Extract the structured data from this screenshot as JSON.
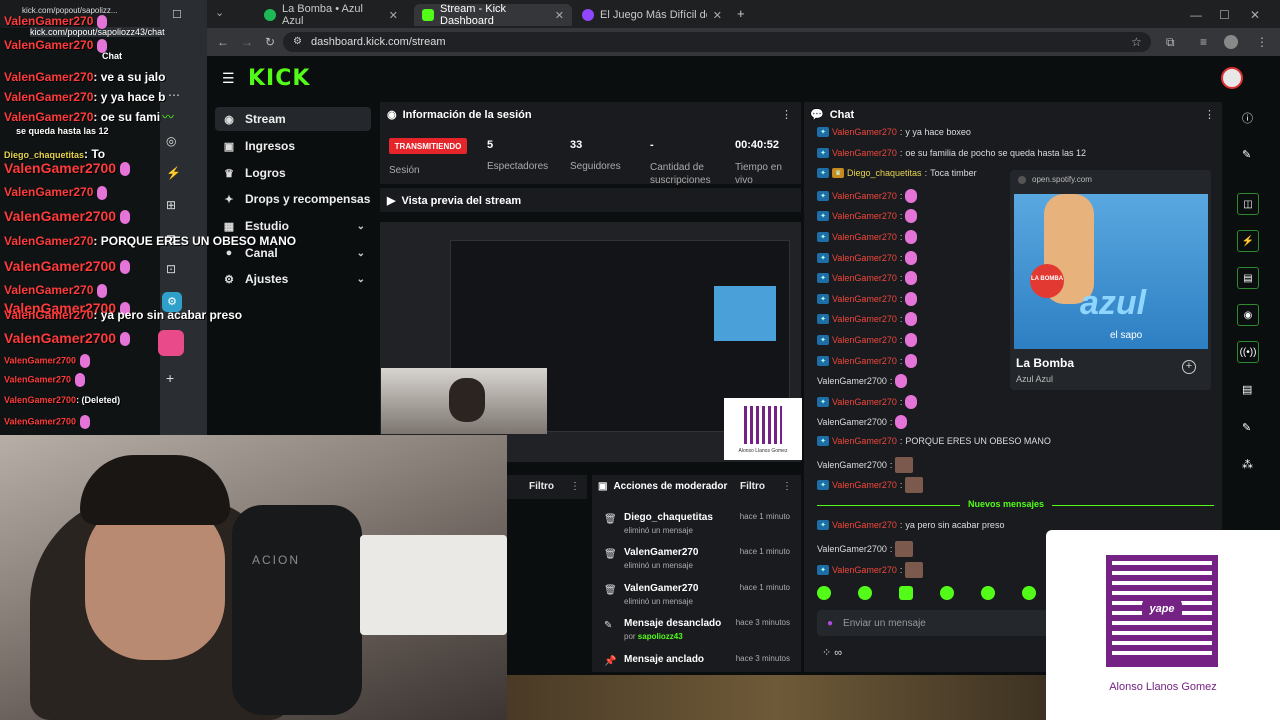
{
  "browser": {
    "tabs": [
      {
        "title": "La Bomba • Azul Azul",
        "color": "#1db954"
      },
      {
        "title": "Stream - Kick Dashboard",
        "color": "#53fc18"
      },
      {
        "title": "El Juego Más Difícil del Mundo",
        "color": "#9146ff"
      }
    ],
    "url": "dashboard.kick.com/stream",
    "popout_url": "kick.com/popout/sapoliozz43/chat",
    "popout_url_short": "kick.com/popout/sapolizz..."
  },
  "sidebar": {
    "items": [
      {
        "label": "Stream",
        "icon": "broadcast-icon"
      },
      {
        "label": "Ingresos",
        "icon": "wallet-icon"
      },
      {
        "label": "Logros",
        "icon": "trophy-icon"
      },
      {
        "label": "Drops y recompensas",
        "icon": "gift-icon"
      },
      {
        "label": "Estudio",
        "icon": "layout-icon"
      },
      {
        "label": "Canal",
        "icon": "user-icon"
      },
      {
        "label": "Ajustes",
        "icon": "gear-icon"
      }
    ]
  },
  "session": {
    "title": "Información de la sesión",
    "status": "TRANSMITIENDO",
    "status_caption": "Sesión",
    "stats": [
      {
        "value": "5",
        "label": "Espectadores"
      },
      {
        "value": "33",
        "label": "Seguidores"
      },
      {
        "value": "-",
        "label": "Cantidad de suscripciones"
      },
      {
        "value": "00:40:52",
        "label": "Tiempo en vivo"
      }
    ]
  },
  "preview": {
    "title": "Vista previa del stream"
  },
  "filter_label": "Filtro",
  "mod_actions": {
    "title": "Acciones de moderador",
    "filter": "Filtro",
    "rows": [
      {
        "user": "Diego_chaquetitas",
        "action": "eliminó un mensaje",
        "time": "hace 1 minuto"
      },
      {
        "user": "ValenGamer270",
        "action": "eliminó un mensaje",
        "time": "hace 1 minuto"
      },
      {
        "user": "ValenGamer270",
        "action": "eliminó un mensaje",
        "time": "hace 1 minuto"
      },
      {
        "user": "Mensaje desanclado",
        "action": "por",
        "by": "sapoliozz43",
        "time": "hace 3 minutos"
      },
      {
        "user": "Mensaje anclado",
        "action": "",
        "time": "hace 3 minutos"
      }
    ]
  },
  "chat": {
    "title": "Chat",
    "new_messages": "Nuevos mensajes",
    "input_placeholder": "Enviar un mensaje",
    "messages": [
      {
        "user": "ValenGamer270",
        "text": "y ya hace boxeo"
      },
      {
        "user": "ValenGamer270",
        "text": "oe su familia de pocho se queda hasta las 12"
      },
      {
        "user": "Diego_chaquetitas",
        "text": "Toca timber"
      },
      {
        "user": "ValenGamer270",
        "text": ""
      },
      {
        "user": "ValenGamer270",
        "text": ""
      },
      {
        "user": "ValenGamer270",
        "text": ""
      },
      {
        "user": "ValenGamer270",
        "text": ""
      },
      {
        "user": "ValenGamer270",
        "text": ""
      },
      {
        "user": "ValenGamer270",
        "text": ""
      },
      {
        "user": "ValenGamer270",
        "text": ""
      },
      {
        "user": "ValenGamer270",
        "text": ""
      },
      {
        "user": "ValenGamer270",
        "text": ""
      },
      {
        "user": "ValenGamer2700",
        "text": ""
      },
      {
        "user": "ValenGamer270",
        "text": ""
      },
      {
        "user": "ValenGamer2700",
        "text": ""
      },
      {
        "user": "ValenGamer270",
        "text": "PORQUE ERES UN OBESO MANO"
      },
      {
        "user": "ValenGamer2700",
        "text": ""
      },
      {
        "user": "ValenGamer270",
        "text": ""
      }
    ],
    "after_new": [
      {
        "user": "ValenGamer270",
        "text": "ya pero sin acabar preso"
      },
      {
        "user": "ValenGamer2700",
        "text": ""
      },
      {
        "user": "ValenGamer270",
        "text": ""
      }
    ]
  },
  "spotify": {
    "domain": "open.spotify.com",
    "song": "La Bomba",
    "artist": "Azul Azul",
    "cover_word": "azul",
    "cover_small": "el sapo",
    "cover_sticker": "LA BOMBA"
  },
  "overlay_chat": {
    "label": "Chat",
    "lines": [
      {
        "name": "ValenGamer270",
        "text": ""
      },
      {
        "name": "ValenGamer270",
        "text": ""
      },
      {
        "name": "ValenGamer270",
        "text": ": ve a su jalo"
      },
      {
        "name": "ValenGamer270",
        "text": ": y ya hace b"
      },
      {
        "name": "ValenGamer270",
        "text": ": oe su fami"
      },
      {
        "name": "",
        "text": "se queda hasta las 12"
      },
      {
        "name": "Diego_chaquetitas",
        "text": ": To"
      },
      {
        "name": "ValenGamer2700",
        "text": ""
      },
      {
        "name": "ValenGamer270",
        "text": ""
      },
      {
        "name": "ValenGamer2700",
        "text": ""
      },
      {
        "name": "ValenGamer270",
        "text": ": PORQUE ERES UN OBESO MANO"
      },
      {
        "name": "ValenGamer2700",
        "text": ""
      },
      {
        "name": "ValenGamer270",
        "text": ""
      },
      {
        "name": "ValenGamer2700",
        "text": ""
      },
      {
        "name": "ValenGamer270",
        "text": ": ya pero sin acabar preso"
      },
      {
        "name": "ValenGamer2700",
        "text": ""
      },
      {
        "name": "ValenGamer2700",
        "text": ""
      },
      {
        "name": "ValenGamer270",
        "text": ""
      },
      {
        "name": "ValenGamer2700",
        "text": ": (Deleted)"
      },
      {
        "name": "ValenGamer2700",
        "text": ""
      }
    ]
  },
  "cam_brand": "ACION",
  "donation": {
    "name": "Alonso Llanos Gomez",
    "brand": "yape",
    "small_name": "Alonso Llanos Gomez"
  },
  "colors": {
    "kick_green": "#53fc18",
    "live_red": "#e5252a",
    "username_red": "#f0473c",
    "yape_purple": "#742284"
  }
}
